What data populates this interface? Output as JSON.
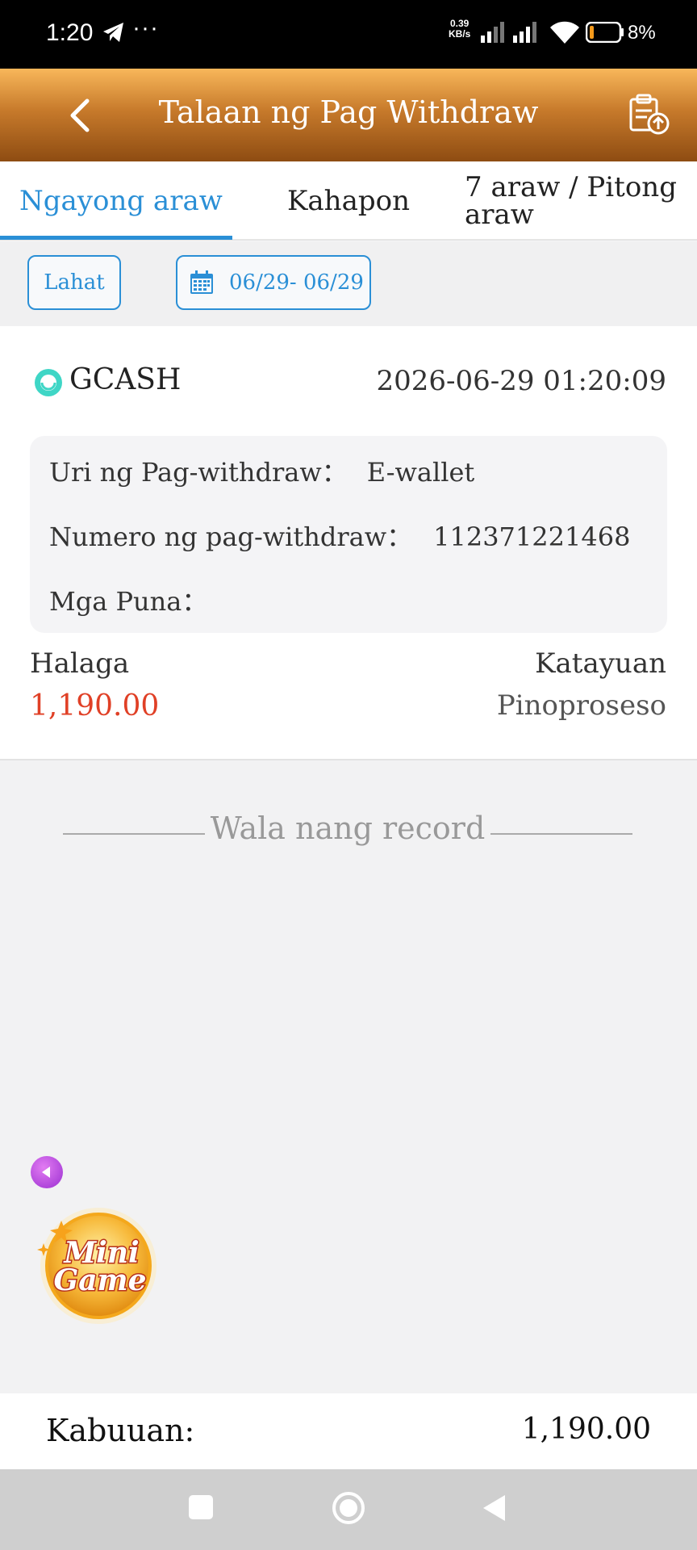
{
  "status_bar": {
    "time": "1:20",
    "more": "···",
    "speed_value": "0.39",
    "speed_unit": "KB/s",
    "battery": "8%"
  },
  "header": {
    "title": "Talaan ng Pag Withdraw"
  },
  "tabs": [
    {
      "label": "Ngayong araw",
      "active": true
    },
    {
      "label": "Kahapon",
      "active": false
    },
    {
      "label": "7 araw / Pitong araw",
      "active": false
    }
  ],
  "filters": {
    "all_label": "Lahat",
    "date_range": "06/29- 06/29"
  },
  "record": {
    "method": "GCASH",
    "datetime": "2026-06-29 01:20:09",
    "type_label": "Uri ng Pag-withdraw：",
    "type_value": "E-wallet",
    "number_label": "Numero ng pag-withdraw：",
    "number_value": "112371221468",
    "remarks_label": "Mga Puna：",
    "remarks_value": "",
    "amount_label": "Halaga",
    "amount_value": "1,190.00",
    "status_label": "Katayuan",
    "status_value": "Pinoproseso"
  },
  "no_more_text": "Wala nang record",
  "minigame": {
    "line1": "Mini",
    "line2": "Game"
  },
  "total": {
    "label": "Kabuuan:",
    "value": "1,190.00"
  },
  "colors": {
    "accent_blue": "#2a8fd6",
    "amount_red": "#e04026",
    "header_top": "#f8b75a",
    "header_bottom": "#8e4c12"
  }
}
